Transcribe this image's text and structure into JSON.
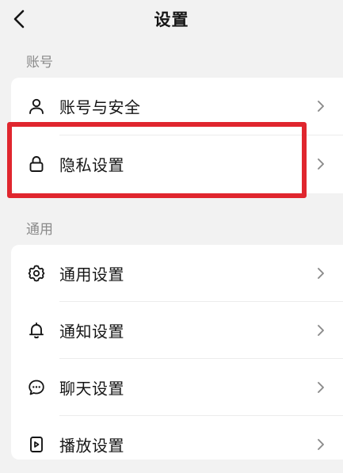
{
  "header": {
    "title": "设置",
    "back_icon": "chevron-left-icon"
  },
  "sections": [
    {
      "label": "账号",
      "items": [
        {
          "label": "账号与安全",
          "icon": "user-icon"
        },
        {
          "label": "隐私设置",
          "icon": "lock-icon"
        }
      ]
    },
    {
      "label": "通用",
      "items": [
        {
          "label": "通用设置",
          "icon": "gear-icon"
        },
        {
          "label": "通知设置",
          "icon": "bell-icon"
        },
        {
          "label": "聊天设置",
          "icon": "chat-icon"
        },
        {
          "label": "播放设置",
          "icon": "play-icon"
        }
      ]
    }
  ],
  "colors": {
    "highlight": "#e0262e",
    "background": "#f2f2f2",
    "card": "#ffffff",
    "chevron": "#8a8a8a"
  }
}
